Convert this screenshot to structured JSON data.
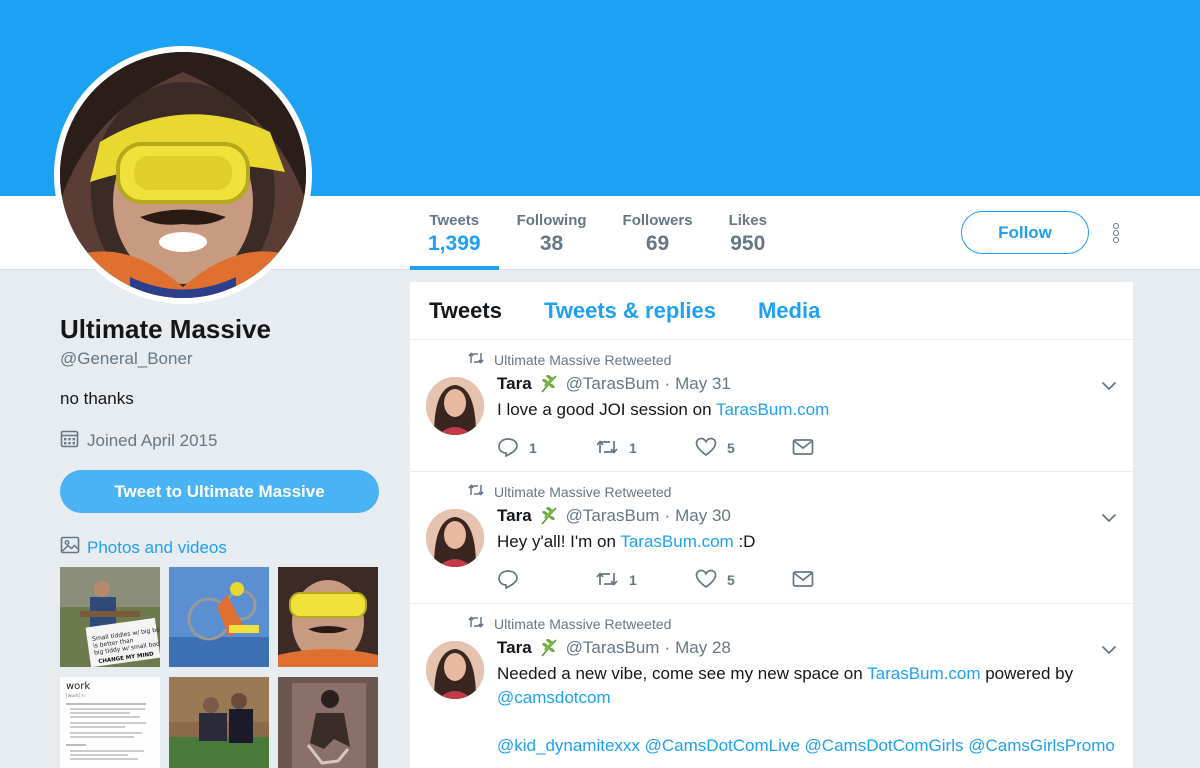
{
  "colors": {
    "accent": "#1da1f2",
    "banner": "#1da1f2",
    "text": "#14171a",
    "muted": "#657786",
    "background": "#e6ecf0"
  },
  "profile": {
    "name": "Ultimate Massive",
    "handle": "@General_Boner",
    "bio": "no thanks",
    "joined": "Joined April 2015",
    "tweet_to_label": "Tweet to Ultimate Massive",
    "photos_label": "Photos and videos",
    "thumb_captions": {
      "meme_line1": "Small tiddies w/ big booty",
      "meme_line2": "is better than",
      "meme_line3": "big tiddy w/ small booty",
      "meme_sign": "CHANGE MY MIND",
      "doc_title": "work",
      "doc_sub": "[wurk] n."
    }
  },
  "stats": [
    {
      "label": "Tweets",
      "value": "1,399"
    },
    {
      "label": "Following",
      "value": "38"
    },
    {
      "label": "Followers",
      "value": "69"
    },
    {
      "label": "Likes",
      "value": "950"
    }
  ],
  "follow_label": "Follow",
  "timeline": {
    "tabs": [
      "Tweets",
      "Tweets & replies",
      "Media"
    ],
    "tweets": [
      {
        "retweeted_by": "Ultimate Massive Retweeted",
        "name": "Tara",
        "handle": "@TarasBum",
        "date": "May 31",
        "text_before": "I love a good JOI session on ",
        "link": "TarasBum.com",
        "text_after": "",
        "replies": "1",
        "retweets": "1",
        "likes": "5"
      },
      {
        "retweeted_by": "Ultimate Massive Retweeted",
        "name": "Tara",
        "handle": "@TarasBum",
        "date": "May 30",
        "text_before": "Hey y'all! I'm on ",
        "link": "TarasBum.com",
        "text_after": " :D",
        "replies": "",
        "retweets": "1",
        "likes": "5"
      },
      {
        "retweeted_by": "Ultimate Massive Retweeted",
        "name": "Tara",
        "handle": "@TarasBum",
        "date": "May 28",
        "text_before": "Needed a new vibe, come see my new space on ",
        "link": "TarasBum.com",
        "text_after": " powered by",
        "mention": "@camsdotcom",
        "mentions_line": "@kid_dynamitexxx @CamsDotComLive @CamsDotComGirls @CamsGirlsPromo"
      }
    ]
  }
}
